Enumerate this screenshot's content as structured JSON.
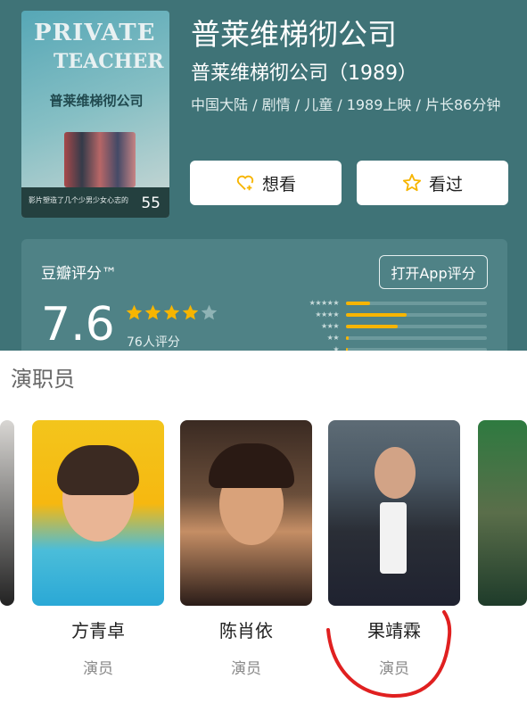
{
  "header": {
    "title": "普莱维梯彻公司",
    "subtitle": "普莱维梯彻公司（1989）",
    "meta": "中国大陆 / 剧情 / 儿童 / 1989上映 / 片长86分钟"
  },
  "poster": {
    "line1": "PRIVATE",
    "line2": "TEACHER",
    "title_cn": "普莱维梯彻公司",
    "strip_text": "影片塑造了几个少男少女心志的",
    "score": "55"
  },
  "actions": {
    "want_label": "想看",
    "seen_label": "看过"
  },
  "rating": {
    "title": "豆瓣评分™",
    "open_app_label": "打开App评分",
    "score": "7.6",
    "stars": 3.8,
    "count_text": "76人评分",
    "distribution": [
      0.17,
      0.43,
      0.37,
      0.02,
      0.01
    ]
  },
  "cast_section": {
    "title": "演职员",
    "members": [
      {
        "name": "方青卓",
        "role": "演员"
      },
      {
        "name": "陈肖依",
        "role": "演员"
      },
      {
        "name": "果靖霖",
        "role": "演员"
      }
    ]
  },
  "colors": {
    "header_bg": "#3f7377",
    "rating_bg": "#4f8286",
    "star": "#f7b500",
    "annotation": "#e02020"
  }
}
